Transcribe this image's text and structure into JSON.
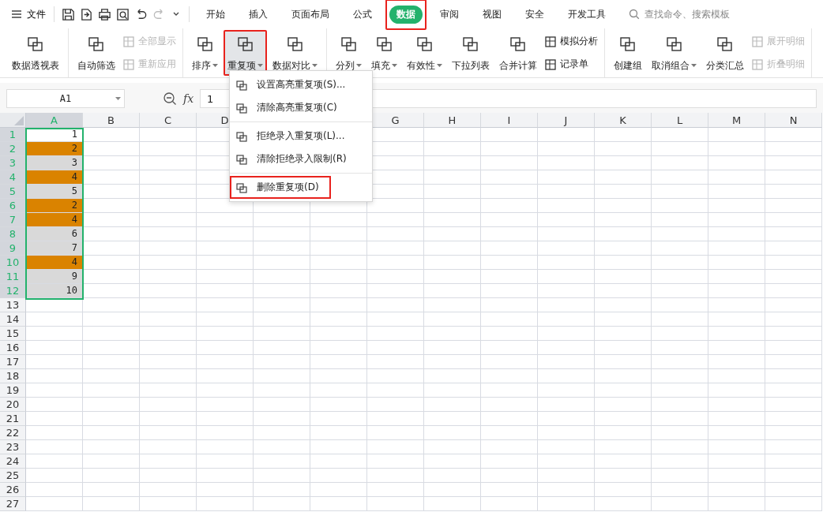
{
  "menubar": {
    "file_label": "文件",
    "tabs": [
      {
        "label": "开始",
        "selected": false,
        "annotated": false
      },
      {
        "label": "插入",
        "selected": false,
        "annotated": false
      },
      {
        "label": "页面布局",
        "selected": false,
        "annotated": false
      },
      {
        "label": "公式",
        "selected": false,
        "annotated": false
      },
      {
        "label": "数据",
        "selected": true,
        "annotated": true
      },
      {
        "label": "审阅",
        "selected": false,
        "annotated": false
      },
      {
        "label": "视图",
        "selected": false,
        "annotated": false
      },
      {
        "label": "安全",
        "selected": false,
        "annotated": false
      },
      {
        "label": "开发工具",
        "selected": false,
        "annotated": false
      }
    ],
    "search": {
      "placeholder": "查找命令、搜索模板"
    }
  },
  "ribbon": {
    "groups": [
      {
        "items": [
          {
            "kind": "large",
            "label": "数据透视表",
            "dropdown": false,
            "annotated": false
          }
        ]
      },
      {
        "items": [
          {
            "kind": "large",
            "label": "自动筛选",
            "dropdown": false,
            "annotated": false
          },
          {
            "kind": "stack",
            "entries": [
              {
                "label": "全部显示",
                "disabled": true
              },
              {
                "label": "重新应用",
                "disabled": true
              }
            ]
          }
        ]
      },
      {
        "items": [
          {
            "kind": "large",
            "label": "排序",
            "dropdown": true,
            "annotated": false
          },
          {
            "kind": "large",
            "label": "重复项",
            "dropdown": true,
            "annotated": true
          },
          {
            "kind": "large",
            "label": "数据对比",
            "dropdown": true,
            "annotated": false
          }
        ]
      },
      {
        "items": [
          {
            "kind": "large",
            "label": "分列",
            "dropdown": true,
            "annotated": false
          },
          {
            "kind": "large",
            "label": "填充",
            "dropdown": true,
            "annotated": false
          },
          {
            "kind": "large",
            "label": "有效性",
            "dropdown": true,
            "annotated": false
          },
          {
            "kind": "large",
            "label": "下拉列表",
            "dropdown": false,
            "annotated": false
          },
          {
            "kind": "large",
            "label": "合并计算",
            "dropdown": false,
            "annotated": false
          },
          {
            "kind": "stack",
            "entries": [
              {
                "label": "模拟分析",
                "disabled": false
              },
              {
                "label": "记录单",
                "disabled": false
              }
            ]
          }
        ]
      },
      {
        "items": [
          {
            "kind": "large",
            "label": "创建组",
            "dropdown": false,
            "annotated": false
          },
          {
            "kind": "large",
            "label": "取消组合",
            "dropdown": true,
            "annotated": false
          },
          {
            "kind": "large",
            "label": "分类汇总",
            "dropdown": false,
            "annotated": false
          },
          {
            "kind": "stack",
            "entries": [
              {
                "label": "展开明细",
                "disabled": true
              },
              {
                "label": "折叠明细",
                "disabled": true
              }
            ]
          }
        ]
      }
    ]
  },
  "dropdown_menu": {
    "sections": [
      [
        {
          "label": "设置高亮重复项(S)...",
          "annotated": false
        },
        {
          "label": "清除高亮重复项(C)",
          "annotated": false
        }
      ],
      [
        {
          "label": "拒绝录入重复项(L)...",
          "annotated": false
        },
        {
          "label": "清除拒绝录入限制(R)",
          "annotated": false
        }
      ],
      [
        {
          "label": "删除重复项(D)",
          "annotated": true
        }
      ]
    ]
  },
  "formula_bar": {
    "name_box": "A1",
    "fx": "fx",
    "value": "1"
  },
  "sheet": {
    "columns": [
      {
        "label": "A",
        "selected": true
      },
      {
        "label": "B",
        "selected": false
      },
      {
        "label": "C",
        "selected": false
      },
      {
        "label": "D",
        "selected": false
      },
      {},
      {},
      {
        "label": "G",
        "selected": false
      },
      {
        "label": "H",
        "selected": false
      },
      {
        "label": "I",
        "selected": false
      },
      {
        "label": "J",
        "selected": false
      },
      {
        "label": "K",
        "selected": false
      },
      {
        "label": "L",
        "selected": false
      },
      {
        "label": "M",
        "selected": false
      },
      {
        "label": "N",
        "selected": false
      }
    ],
    "rows": [
      {
        "number": "1",
        "value": "1",
        "selected": true,
        "duplicate": false,
        "active": true
      },
      {
        "number": "2",
        "value": "2",
        "selected": true,
        "duplicate": true,
        "active": false
      },
      {
        "number": "3",
        "value": "3",
        "selected": true,
        "duplicate": false,
        "active": false
      },
      {
        "number": "4",
        "value": "4",
        "selected": true,
        "duplicate": true,
        "active": false
      },
      {
        "number": "5",
        "value": "5",
        "selected": true,
        "duplicate": false,
        "active": false
      },
      {
        "number": "6",
        "value": "2",
        "selected": true,
        "duplicate": true,
        "active": false
      },
      {
        "number": "7",
        "value": "4",
        "selected": true,
        "duplicate": true,
        "active": false
      },
      {
        "number": "8",
        "value": "6",
        "selected": true,
        "duplicate": false,
        "active": false
      },
      {
        "number": "9",
        "value": "7",
        "selected": true,
        "duplicate": false,
        "active": false
      },
      {
        "number": "10",
        "value": "4",
        "selected": true,
        "duplicate": true,
        "active": false
      },
      {
        "number": "11",
        "value": "9",
        "selected": true,
        "duplicate": false,
        "active": false
      },
      {
        "number": "12",
        "value": "10",
        "selected": true,
        "duplicate": false,
        "active": false
      },
      {
        "number": "13",
        "selected": false
      },
      {
        "number": "14",
        "selected": false
      },
      {
        "number": "15",
        "selected": false
      },
      {
        "number": "16",
        "selected": false
      },
      {
        "number": "17",
        "selected": false
      },
      {
        "number": "18",
        "selected": false
      },
      {
        "number": "19",
        "selected": false
      },
      {
        "number": "20",
        "selected": false
      },
      {
        "number": "21",
        "selected": false
      },
      {
        "number": "22",
        "selected": false
      },
      {
        "number": "23",
        "selected": false
      },
      {
        "number": "24",
        "selected": false
      },
      {
        "number": "25",
        "selected": false
      },
      {
        "number": "26",
        "selected": false
      },
      {
        "number": "27",
        "selected": false
      }
    ]
  }
}
